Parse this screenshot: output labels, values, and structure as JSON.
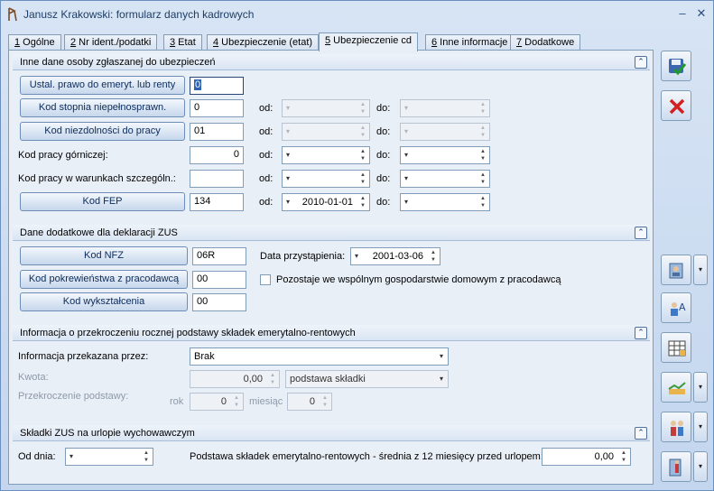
{
  "window": {
    "title": "Janusz Krakowski: formularz danych kadrowych"
  },
  "tabs": [
    {
      "num": "1",
      "label": " Ogólne"
    },
    {
      "num": "2",
      "label": " Nr ident./podatki"
    },
    {
      "num": "3",
      "label": " Etat"
    },
    {
      "num": "4",
      "label": " Ubezpieczenie (etat)"
    },
    {
      "num": "5",
      "label": " Ubezpieczenie cd"
    },
    {
      "num": "6",
      "label": " Inne informacje"
    },
    {
      "num": "7",
      "label": " Dodatkowe"
    }
  ],
  "section1": {
    "title": "Inne dane osoby zgłaszanej do ubezpieczeń",
    "btn_emeryt": "Ustal. prawo do emeryt. lub renty",
    "val_emeryt": "0",
    "btn_stopien": "Kod stopnia niepełnosprawn.",
    "val_stopien": "0",
    "btn_niezdolnosc": "Kod niezdolności do pracy",
    "val_niezdolnosc": "01",
    "lbl_gorniczej": "Kod pracy górniczej:",
    "val_gorniczej": "0",
    "lbl_warunki": "Kod pracy w warunkach szczególn.:",
    "val_warunki": "",
    "btn_fep": "Kod FEP",
    "val_fep": "134",
    "od": "od:",
    "do": "do:",
    "fep_od_date": "2010-01-01"
  },
  "section2": {
    "title": "Dane dodatkowe dla deklaracji ZUS",
    "btn_nfz": "Kod NFZ",
    "val_nfz": "06R",
    "lbl_data": "Data przystąpienia:",
    "val_data": "2001-03-06",
    "btn_pokrew": "Kod pokrewieństwa z pracodawcą",
    "val_pokrew": "00",
    "chk_label": "Pozostaje we wspólnym gospodarstwie domowym z pracodawcą",
    "btn_wyksz": "Kod wykształcenia",
    "val_wyksz": "00"
  },
  "section3": {
    "title": "Informacja o przekroczeniu rocznej podstawy składek emerytalno-rentowych",
    "lbl_info": "Informacja przekazana przez:",
    "val_info": "Brak",
    "lbl_kwota": "Kwota:",
    "val_kwota": "0,00",
    "val_podstawa": "podstawa składki",
    "lbl_przekr": "Przekroczenie podstawy:",
    "lbl_rok": "rok",
    "val_rok": "0",
    "lbl_miesiac": "miesiąc",
    "val_miesiac": "0"
  },
  "section4": {
    "title": "Składki ZUS na urlopie wychowawczym",
    "lbl_od": "Od dnia:",
    "lbl_podstawa": "Podstawa składek emerytalno-rentowych - średnia z 12 miesięcy przed urlopem:",
    "val_podstawa": "0,00"
  },
  "glyphs": {
    "collapse": "⌃",
    "dd": "▾",
    "up": "▲",
    "down": "▼",
    "min": "–",
    "close": "✕"
  }
}
